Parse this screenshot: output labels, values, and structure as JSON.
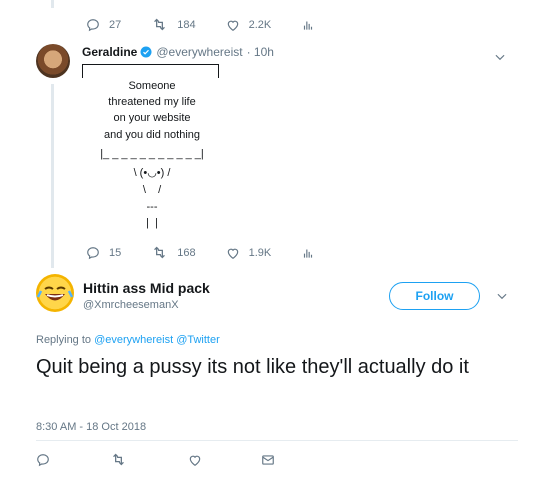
{
  "top_actions": {
    "replies": "27",
    "retweets": "184",
    "likes": "2.2K"
  },
  "tweet1": {
    "name": "Geraldine",
    "handle": "@everywhereist",
    "time": "· 10h",
    "sign_lines": [
      "Someone",
      "threatened my life",
      "on your website",
      "and you did nothing"
    ],
    "dash_line": "|_ _ _ _ _ _ _ _ _ _ _|",
    "bunny_lines": [
      "\\ (•◡•) /",
      "\\    /",
      "---",
      "|  |"
    ],
    "actions": {
      "replies": "15",
      "retweets": "168",
      "likes": "1.9K"
    }
  },
  "tweet2": {
    "name": "Hittin ass Mid pack",
    "handle": "@XmrcheesemanX",
    "follow_label": "Follow",
    "replying_prefix": "Replying to",
    "replying_users": "@everywhereist @Twitter",
    "text": "Quit being a pussy its not like they'll actually do it",
    "timestamp": "8:30 AM - 18 Oct 2018"
  },
  "colors": {
    "accent": "#1da1f2",
    "muted": "#657786",
    "text": "#14171a"
  }
}
